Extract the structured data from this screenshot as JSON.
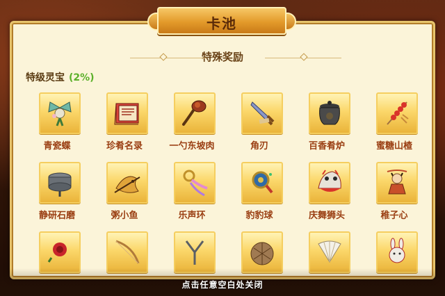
{
  "window": {
    "title": "卡池"
  },
  "section": {
    "title": "特殊奖励"
  },
  "tier": {
    "name": "特级灵宝",
    "percent": "(2%)"
  },
  "items": [
    {
      "label": "青瓷蝶",
      "icon": "celadon-butterfly-icon"
    },
    {
      "label": "珍肴名录",
      "icon": "recipe-book-icon"
    },
    {
      "label": "一勺东坡肉",
      "icon": "ladle-icon"
    },
    {
      "label": "角刃",
      "icon": "blade-icon"
    },
    {
      "label": "百香肴炉",
      "icon": "cooking-pot-icon"
    },
    {
      "label": "蜜糖山楂",
      "icon": "candied-hawthorn-icon"
    },
    {
      "label": "静研石磨",
      "icon": "stone-mill-icon"
    },
    {
      "label": "粥小鱼",
      "icon": "golden-fish-icon"
    },
    {
      "label": "乐声环",
      "icon": "music-ring-icon"
    },
    {
      "label": "豹豹球",
      "icon": "leopard-ball-icon"
    },
    {
      "label": "庆舞狮头",
      "icon": "lion-dance-head-icon"
    },
    {
      "label": "稚子心",
      "icon": "child-doll-icon"
    },
    {
      "label": "",
      "icon": "red-flower-icon"
    },
    {
      "label": "",
      "icon": "bow-icon"
    },
    {
      "label": "",
      "icon": "tongs-icon"
    },
    {
      "label": "",
      "icon": "woven-basket-icon"
    },
    {
      "label": "",
      "icon": "folding-fan-icon"
    },
    {
      "label": "",
      "icon": "rabbit-toy-icon"
    }
  ],
  "footer": {
    "hint": "点击任意空白处关闭"
  },
  "colors": {
    "label": "#9a3e12",
    "percent": "#5bb02a",
    "accent": "#e39a2a"
  }
}
